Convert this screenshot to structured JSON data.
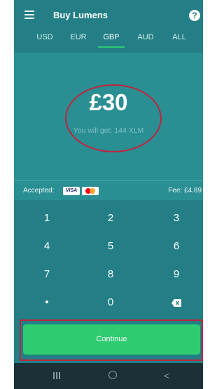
{
  "header": {
    "title": "Buy Lumens",
    "menu_icon": "hamburger-menu-icon",
    "help_label": "?"
  },
  "tabs": [
    {
      "label": "USD",
      "active": false
    },
    {
      "label": "EUR",
      "active": false
    },
    {
      "label": "GBP",
      "active": true
    },
    {
      "label": "AUD",
      "active": false
    },
    {
      "label": "ALL",
      "active": false
    }
  ],
  "purchase": {
    "amount": "£30",
    "receive_text": "You will get: 144 XLM"
  },
  "payment": {
    "accepted_label": "Accepted:",
    "visa_label": "VISA",
    "fee_text": "Fee: £4.89"
  },
  "keypad": {
    "keys": [
      "1",
      "2",
      "3",
      "4",
      "5",
      "6",
      "7",
      "8",
      "9",
      "•",
      "0"
    ],
    "backspace_icon": "backspace-icon"
  },
  "continue_button": {
    "label": "Continue"
  },
  "colors": {
    "header": "#237f85",
    "panel": "#2a8f93",
    "accent_green": "#2ecb71",
    "annotation_red": "#c2233d",
    "navbar": "#1c3038"
  },
  "navbar": {
    "recents_icon": "recents-icon",
    "home_icon": "home-icon",
    "back_glyph": "<"
  }
}
